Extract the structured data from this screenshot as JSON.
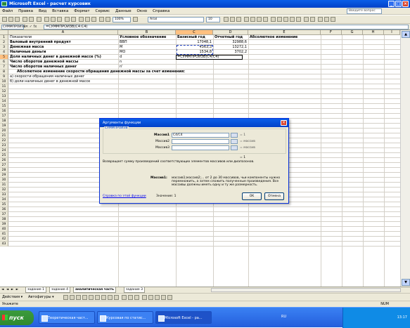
{
  "window": {
    "title": "Microsoft Excel - расчет курсовик"
  },
  "menubar": {
    "items": [
      "Файл",
      "Правка",
      "Вид",
      "Вставка",
      "Формат",
      "Сервис",
      "Данные",
      "Окно",
      "Справка"
    ],
    "help_placeholder": "Введите вопрос"
  },
  "toolbar": {
    "zoom": "100%",
    "font": "Arial",
    "font_size": "10"
  },
  "formula": {
    "namebox": "СУММПРОИЗВ",
    "fx": "✕ ✓ fx",
    "content": "=СУММПРОИЗВ(C4:C4)"
  },
  "columns": [
    "A",
    "B",
    "C",
    "D",
    "E",
    "F",
    "G",
    "H",
    "I"
  ],
  "rows": [
    "1",
    "2",
    "3",
    "4",
    "5",
    "6",
    "7",
    "8",
    "9",
    "10",
    "11",
    "12",
    "13",
    "14",
    "15",
    "16",
    "17",
    "18",
    "19",
    "20",
    "21",
    "22",
    "23",
    "24",
    "25",
    "26",
    "27",
    "28",
    "29",
    "30",
    "31",
    "32",
    "33",
    "34",
    "35",
    "36",
    "37",
    "38",
    "39",
    "40",
    "41",
    "42",
    "43"
  ],
  "cells": {
    "a1": "Показатели",
    "b1": "Условное обозначение",
    "c1": "Базисный год",
    "d1": "Отчетный год",
    "e1": "Абсолютное изменение",
    "a2": "Валовый внутренний продукт",
    "b2": "ВВП",
    "c2": "17048,1",
    "d2": "32988,6",
    "a3": "Денежная масса",
    "b3": "М",
    "c3": "4363,3",
    "d3": "13272,1",
    "a4": "Наличные деньги",
    "b4": "МО",
    "c4": "1534,8",
    "d4": "3702,2",
    "a5": "Доля наличных денег в денежной массе (%)",
    "b5": "d",
    "c5": "=СУММПРОИЗВ(C4/C4)",
    "a6": "Число оборотов денежной массы",
    "b6": "n",
    "a7": "Число оборотов наличных денег",
    "b7": "n'",
    "a8": "Абсолютное изменение скорости обращения денежной массы за счет изменения:",
    "a9": "а) скорости обращения наличных денег",
    "a10": "б) доли наличных денег в денежной массе"
  },
  "dialog": {
    "title": "Аргументы функции",
    "function_name": "СУММПРОИЗВ",
    "args": [
      {
        "label": "Массив1",
        "value": "C4/C4",
        "result": "= 1"
      },
      {
        "label": "Массив2",
        "value": "",
        "result": "= массив"
      },
      {
        "label": "Массив3",
        "value": "",
        "result": "= массив"
      }
    ],
    "total_result": "= 1",
    "description": "Возвращает сумму произведений соответствующих элементов массивов или диапазонов.",
    "arg_help_label": "Массив1:",
    "arg_help": "массив1;массив2;... от 2 до 30 массивов, чьи компоненты нужно перемножить, а затем сложить полученные произведения. Все массивы должны иметь одну и ту же размерность.",
    "help_link": "Справка по этой функции",
    "value_label": "Значение: 1",
    "ok": "OK",
    "cancel": "Отмена"
  },
  "tabs": {
    "nav": "◄ ◄ ► ►",
    "items": [
      "задание 1",
      "задание 4",
      "аналитическая часть",
      "задание 3"
    ],
    "active": 2
  },
  "drawbar": {
    "actions": "Действия ▾",
    "autoshapes": "Автофигуры ▾"
  },
  "status": {
    "mode": "Укажите",
    "num": "NUM"
  },
  "taskbar": {
    "start": "пуск",
    "tasks": [
      "Теоретическая част...",
      "Курсовая по статис...",
      "Microsoft Excel - ра..."
    ],
    "lang": "RU",
    "clock": "13:17"
  }
}
